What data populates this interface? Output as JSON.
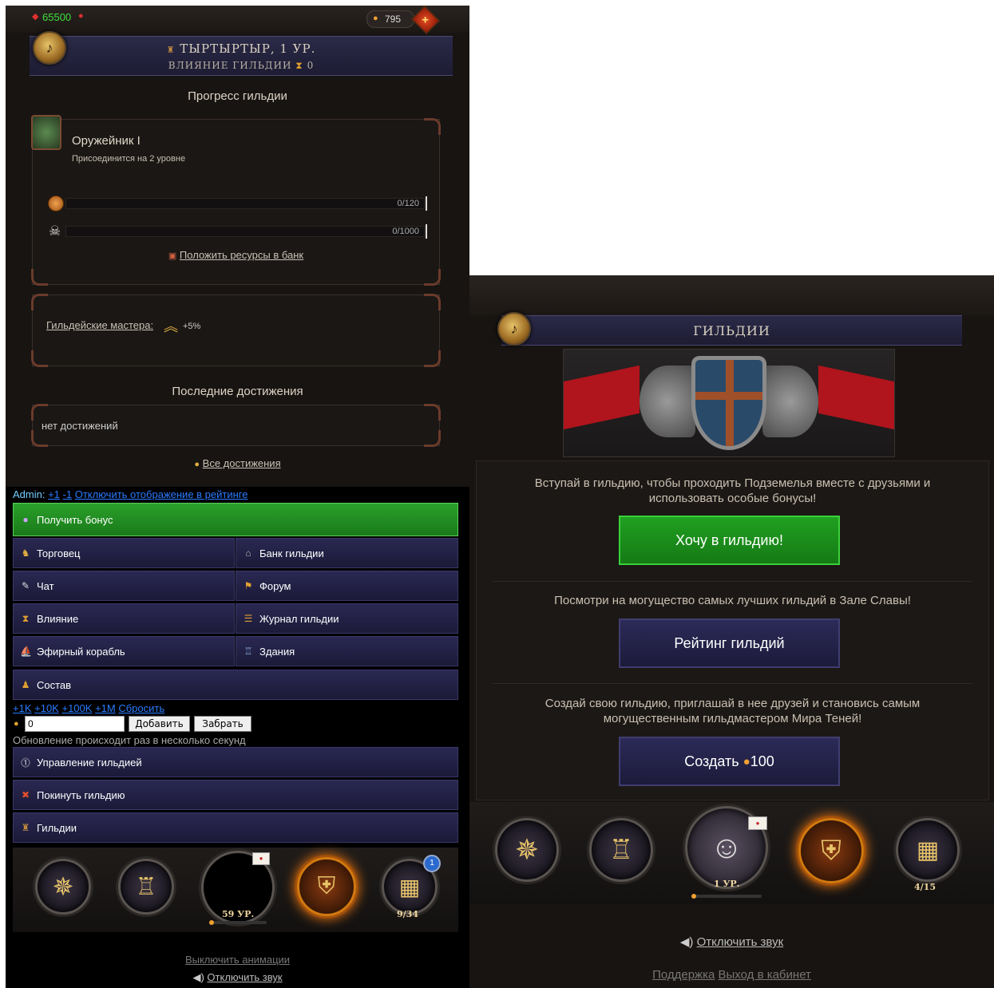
{
  "left": {
    "top_bar": {
      "rubies": "65500",
      "gems": "795",
      "plus": "+"
    },
    "guild_name": "ТЫРТЫРТЫР, 1 УР.",
    "guild_influence_label": "ВЛИЯНИЕ ГИЛЬДИИ",
    "guild_influence_value": "0",
    "progress_title": "Прогресс гильдии",
    "rank_name": "Оружейник I",
    "rank_note": "Присоединится на 2 уровне",
    "bar1": {
      "text": "0/120",
      "fill": 0
    },
    "bar2": {
      "text": "0/1000",
      "fill": 0
    },
    "deposit_link": "Положить ресурсы в банк",
    "masters_link": "Гильдейские мастера:",
    "masters_bonus": "+5%",
    "achievements_title": "Последние достижения",
    "achievements_empty": "нет достижений",
    "all_achievements": "Все достижения",
    "admin_label": "Admin:",
    "admin_plus": "+1",
    "admin_minus": "-1",
    "admin_toggle": "Отключить отображение в рейтинге",
    "bonus_btn": "Получить бонус",
    "menu": [
      "Торговец",
      "Банк гильдии",
      "Чат",
      "Форум",
      "Влияние",
      "Журнал гильдии",
      "Эфирный корабль",
      "Здания",
      "Состав"
    ],
    "amounts": [
      "+1K",
      "+10K",
      "+100K",
      "+1M",
      "Сбросить"
    ],
    "amount_value": "0",
    "add_btn": "Добавить",
    "take_btn": "Забрать",
    "update_note": "Обновление происходит раз в несколько секунд",
    "manage_btn": "Управление гильдией",
    "leave_btn": "Покинуть гильдию",
    "guilds_btn": "Гильдии",
    "dock_level": "59 УР.",
    "dock_count": "9/34",
    "dock_badge": "1",
    "disable_anim": "Выключить анимации",
    "mute": "Отключить звук"
  },
  "right": {
    "header_title": "ГИЛЬДИИ",
    "join_text": "Вступай в гильдию, чтобы проходить Подземелья вместе с друзьями и использовать особые бонусы!",
    "join_btn": "Хочу в гильдию!",
    "rating_text": "Посмотри на могущество самых лучших гильдий в Зале Славы!",
    "rating_btn": "Рейтинг гильдий",
    "create_text": "Создай свою гильдию, приглашай в нее друзей и становись самым могущественным гильдмастером Мира Теней!",
    "create_btn": "Создать",
    "create_cost": "100",
    "dock_level": "1 УР.",
    "dock_count": "4/15",
    "mute": "Отключить звук",
    "support": "Поддержка",
    "logout": "Выход в кабинет"
  },
  "colors": {
    "green_btn": "#1f8a1f",
    "nav_btn": "#232148",
    "link_blue": "#2a7bff",
    "orange_glow": "#d27a10"
  }
}
